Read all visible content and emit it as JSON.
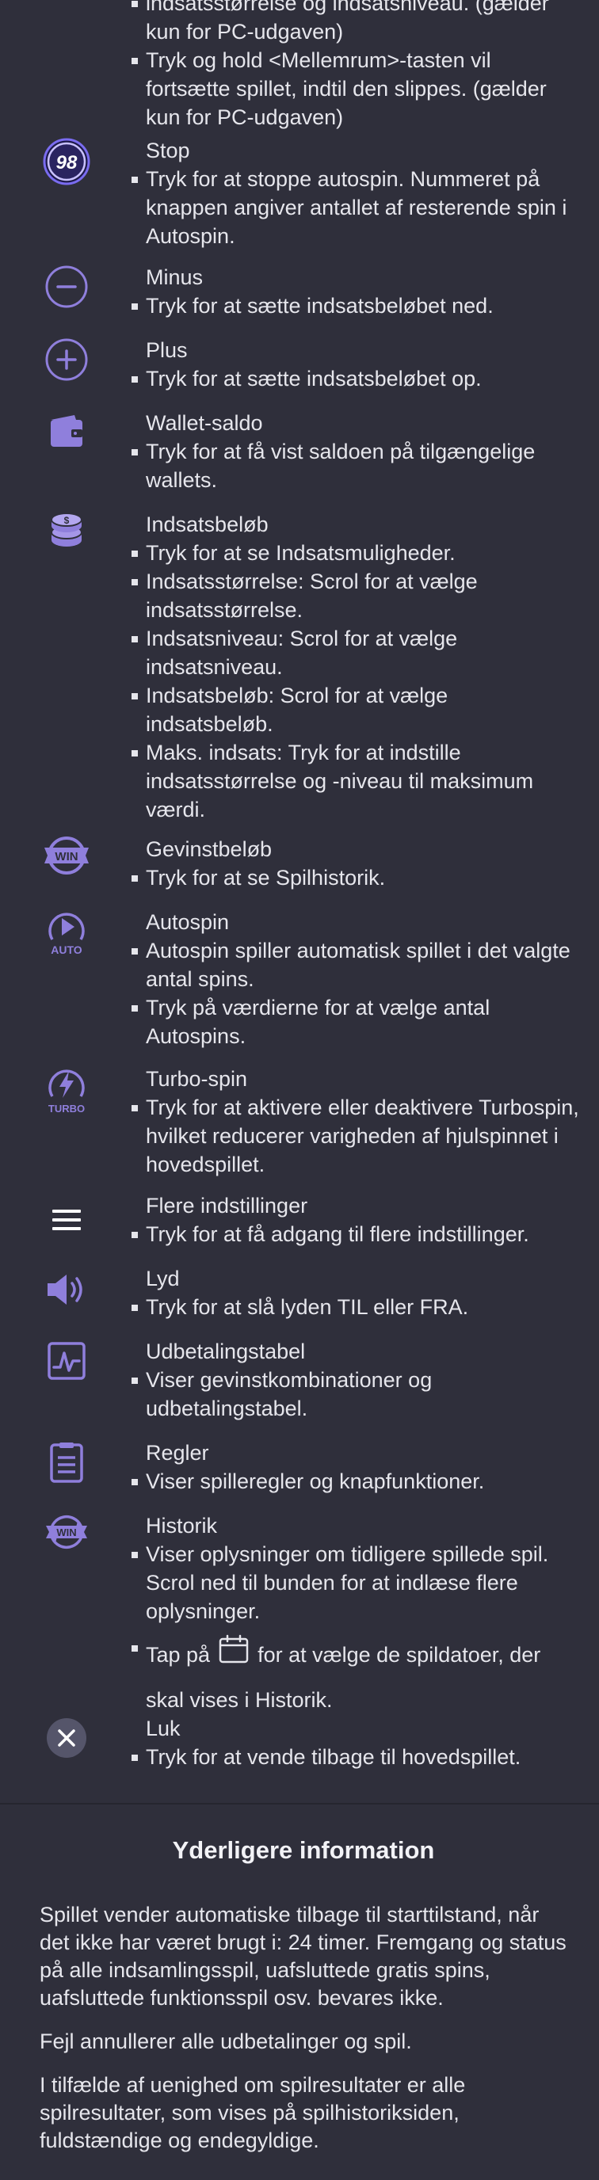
{
  "colors": {
    "background": "#2f2f3b",
    "icon_purple": "#8f7fdc",
    "text": "#e6e6ec"
  },
  "top_partial": {
    "line_cut": "indsatsstørrelse og indsatsniveau. (gælder",
    "line_1": "kun for PC-udgaven)",
    "bullet_2": "Tryk og hold <Mellemrum>-tasten vil fortsætte spillet, indtil den slippes. (gælder kun for PC-udgaven)"
  },
  "items": [
    {
      "key": "stop",
      "icon": "stop-counter-icon",
      "badge": "98",
      "title": "Stop",
      "bullets": [
        "Tryk for at stoppe autospin. Nummeret på knappen angiver antallet af resterende spin i Autospin."
      ]
    },
    {
      "key": "minus",
      "icon": "minus-icon",
      "title": "Minus",
      "bullets": [
        "Tryk for at sætte indsatsbeløbet ned."
      ]
    },
    {
      "key": "plus",
      "icon": "plus-icon",
      "title": "Plus",
      "bullets": [
        "Tryk for at sætte indsatsbeløbet op."
      ]
    },
    {
      "key": "wallet",
      "icon": "wallet-icon",
      "title": "Wallet-saldo",
      "bullets": [
        "Tryk for at få vist saldoen på tilgængelige wallets."
      ]
    },
    {
      "key": "bet",
      "icon": "coin-stack-icon",
      "title": "Indsatsbeløb",
      "bullets": [
        "Tryk for at se Indsatsmuligheder.",
        "Indsatsstørrelse: Scrol for at vælge indsatsstørrelse.",
        "Indsatsniveau: Scrol for at vælge indsatsniveau.",
        "Indsatsbeløb: Scrol for at vælge indsatsbeløb.",
        "Maks. indsats: Tryk for at indstille indsatsstørrelse og -niveau til maksimum værdi."
      ]
    },
    {
      "key": "win",
      "icon": "win-badge-icon",
      "badge": "WIN",
      "title": "Gevinstbeløb",
      "bullets": [
        "Tryk for at se Spilhistorik."
      ]
    },
    {
      "key": "autospin",
      "icon": "autospin-icon",
      "badge": "AUTO",
      "title": "Autospin",
      "bullets": [
        "Autospin spiller automatisk spillet i det valgte antal spins.",
        "Tryk på værdierne for at vælge antal Autospins."
      ]
    },
    {
      "key": "turbo",
      "icon": "turbo-spin-icon",
      "badge": "TURBO",
      "title": "Turbo-spin",
      "bullets": [
        "Tryk for at aktivere eller deaktivere Turbospin, hvilket reducerer varigheden af hjulspinnet i hovedspillet."
      ]
    },
    {
      "key": "menu",
      "icon": "hamburger-menu-icon",
      "title": "Flere indstillinger",
      "bullets": [
        "Tryk for at få adgang til flere indstillinger."
      ]
    },
    {
      "key": "sound",
      "icon": "speaker-icon",
      "title": "Lyd",
      "bullets": [
        "Tryk for at slå lyden TIL eller FRA."
      ]
    },
    {
      "key": "paytable",
      "icon": "paytable-chart-icon",
      "title": "Udbetalingstabel",
      "bullets": [
        "Viser gevinstkombinationer og udbetalingstabel."
      ]
    },
    {
      "key": "rules",
      "icon": "rules-document-icon",
      "title": "Regler",
      "bullets": [
        "Viser spilleregler og knapfunktioner."
      ]
    },
    {
      "key": "history",
      "icon": "history-win-icon",
      "badge": "WIN",
      "title": "Historik",
      "bullets": [
        "Viser oplysninger om tidligere spillede spil. Scrol ned til bunden for at indlæse flere oplysninger."
      ],
      "tap_prefix": "Tap på",
      "tap_suffix": "for at vælge de spildatoer, der skal vises i Historik."
    },
    {
      "key": "close",
      "icon": "close-icon",
      "title": "Luk",
      "bullets": [
        "Tryk for at vende tilbage til hovedspillet."
      ]
    }
  ],
  "more_info": {
    "heading": "Yderligere information",
    "paragraphs": [
      "Spillet vender automatiske tilbage til starttilstand, når det ikke har været brugt i: 24 timer. Fremgang og status på alle indsamlingsspil, uafsluttede gratis spins, uafsluttede funktionsspil osv. bevares ikke.",
      "Fejl annullerer alle udbetalinger og spil.",
      "I tilfælde af uenighed om spilresultater er alle spilresultater, som vises på spilhistoriksiden, fuldstændige og endegyldige."
    ]
  }
}
